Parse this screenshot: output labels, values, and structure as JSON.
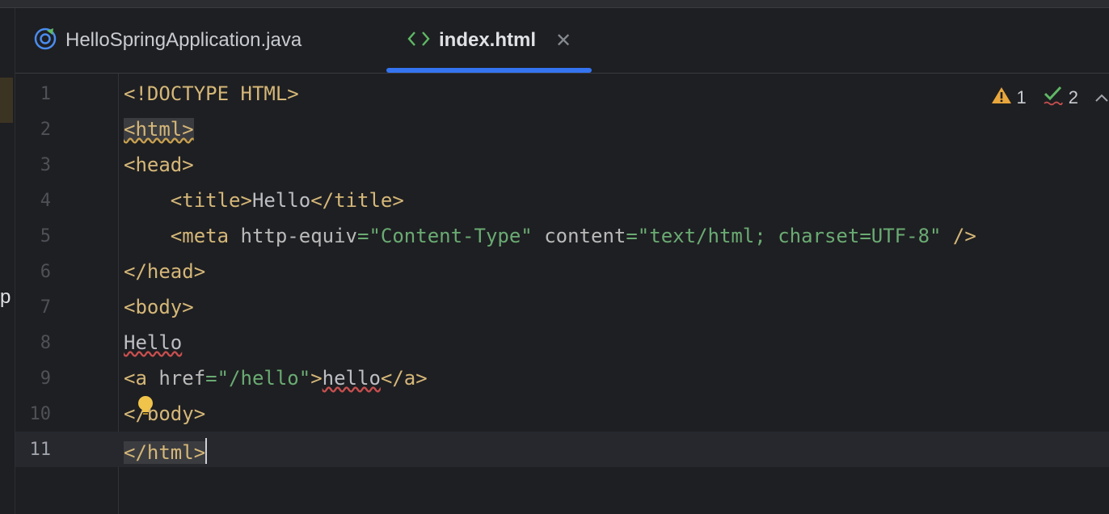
{
  "tabs": [
    {
      "label": "HelloSpringApplication.java",
      "icon": "spring-boot-icon",
      "active": false
    },
    {
      "label": "index.html",
      "icon": "html-code-icon",
      "active": true,
      "close": "✕"
    }
  ],
  "side_panel_letter": "p",
  "inspections": {
    "warnings": "1",
    "typos": "2"
  },
  "colors": {
    "accent": "#3574f0",
    "tag": "#d5b778",
    "string": "#6aab73",
    "warning": "#e8a63c",
    "ok": "#5fb865"
  },
  "lines": [
    {
      "num": "1",
      "parts": [
        "<!DOCTYPE ",
        "HTML",
        ">"
      ]
    },
    {
      "num": "2",
      "parts": [
        "<html>"
      ]
    },
    {
      "num": "3",
      "parts": [
        "<head>"
      ]
    },
    {
      "num": "4",
      "parts": [
        "    <title>",
        "Hello",
        "</title>"
      ]
    },
    {
      "num": "5",
      "parts": [
        "    <meta ",
        "http-equiv",
        "=",
        "\"Content-Type\"",
        " content",
        "=",
        "\"text/html; charset=UTF-8\"",
        " />"
      ]
    },
    {
      "num": "6",
      "parts": [
        "</head>"
      ]
    },
    {
      "num": "7",
      "parts": [
        "<body>"
      ]
    },
    {
      "num": "8",
      "parts": [
        "Hello"
      ]
    },
    {
      "num": "9",
      "parts": [
        "<a ",
        "href",
        "=",
        "\"/hello\"",
        ">",
        "hello",
        "</a>"
      ]
    },
    {
      "num": "10",
      "parts": [
        "</body>"
      ]
    },
    {
      "num": "11",
      "parts": [
        "</html>"
      ]
    }
  ]
}
